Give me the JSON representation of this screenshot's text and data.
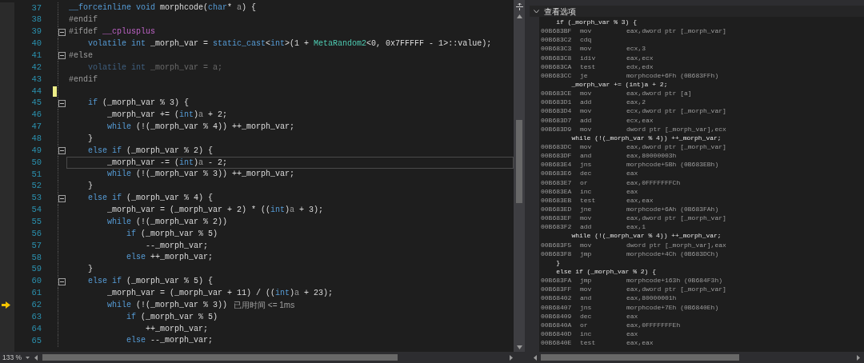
{
  "editor": {
    "lines": [
      {
        "number": "37",
        "fold": false,
        "changed": false,
        "current": false,
        "executing": false,
        "tokens": [
          {
            "kind": "kw",
            "text": "__forceinline void"
          },
          {
            "kind": "plain",
            "text": " morphcode("
          },
          {
            "kind": "kw",
            "text": "char"
          },
          {
            "kind": "plain",
            "text": "* "
          },
          {
            "kind": "param",
            "text": "a"
          },
          {
            "kind": "plain",
            "text": ") {"
          }
        ]
      },
      {
        "number": "38",
        "fold": false,
        "changed": false,
        "current": false,
        "executing": false,
        "tokens": [
          {
            "kind": "pre",
            "text": "#endif"
          }
        ]
      },
      {
        "number": "39",
        "fold": true,
        "changed": false,
        "current": false,
        "executing": false,
        "tokens": [
          {
            "kind": "pre",
            "text": "#ifdef "
          },
          {
            "kind": "macro",
            "text": "__cplusplus"
          }
        ]
      },
      {
        "number": "40",
        "fold": false,
        "changed": false,
        "current": false,
        "executing": false,
        "tokens": [
          {
            "kind": "kw",
            "text": "    volatile int"
          },
          {
            "kind": "plain",
            "text": " _morph_var = "
          },
          {
            "kind": "kw",
            "text": "static_cast"
          },
          {
            "kind": "plain",
            "text": "<"
          },
          {
            "kind": "kw",
            "text": "int"
          },
          {
            "kind": "plain",
            "text": ">(1 + "
          },
          {
            "kind": "type",
            "text": "MetaRandom2"
          },
          {
            "kind": "plain",
            "text": "<0, 0x7FFFFF - 1>::value);"
          }
        ]
      },
      {
        "number": "41",
        "fold": true,
        "changed": false,
        "current": false,
        "executing": false,
        "tokens": [
          {
            "kind": "pre",
            "text": "#else"
          }
        ]
      },
      {
        "number": "42",
        "fold": false,
        "changed": false,
        "current": false,
        "executing": false,
        "tokens": [
          {
            "kind": "dimkw",
            "text": "    volatile int"
          },
          {
            "kind": "dim",
            "text": " _morph_var = a;"
          }
        ]
      },
      {
        "number": "43",
        "fold": false,
        "changed": false,
        "current": false,
        "executing": false,
        "tokens": [
          {
            "kind": "pre",
            "text": "#endif"
          }
        ]
      },
      {
        "number": "44",
        "fold": false,
        "changed": true,
        "current": false,
        "executing": false
      },
      {
        "number": "45",
        "fold": true,
        "changed": false,
        "current": false,
        "executing": false,
        "tokens": [
          {
            "kind": "kw",
            "text": "    if"
          },
          {
            "kind": "plain",
            "text": " (_morph_var % 3) {"
          }
        ]
      },
      {
        "number": "46",
        "fold": false,
        "changed": false,
        "current": false,
        "executing": false,
        "tokens": [
          {
            "kind": "plain",
            "text": "        _morph_var += ("
          },
          {
            "kind": "kw",
            "text": "int"
          },
          {
            "kind": "plain",
            "text": ")"
          },
          {
            "kind": "param",
            "text": "a"
          },
          {
            "kind": "plain",
            "text": " + 2;"
          }
        ]
      },
      {
        "number": "47",
        "fold": false,
        "changed": false,
        "current": false,
        "executing": false,
        "tokens": [
          {
            "kind": "kw",
            "text": "        while"
          },
          {
            "kind": "plain",
            "text": " (!(_morph_var % 4)) ++_morph_var;"
          }
        ]
      },
      {
        "number": "48",
        "fold": false,
        "changed": false,
        "current": false,
        "executing": false,
        "tokens": [
          {
            "kind": "plain",
            "text": "    }"
          }
        ]
      },
      {
        "number": "49",
        "fold": true,
        "changed": false,
        "current": false,
        "executing": false,
        "tokens": [
          {
            "kind": "kw",
            "text": "    else if"
          },
          {
            "kind": "plain",
            "text": " (_morph_var % 2) {"
          }
        ]
      },
      {
        "number": "50",
        "fold": false,
        "changed": false,
        "current": true,
        "executing": false,
        "tokens": [
          {
            "kind": "plain",
            "text": "        _morph_var -= ("
          },
          {
            "kind": "kw",
            "text": "int"
          },
          {
            "kind": "plain",
            "text": ")"
          },
          {
            "kind": "param",
            "text": "a"
          },
          {
            "kind": "plain",
            "text": " - 2;"
          }
        ]
      },
      {
        "number": "51",
        "fold": false,
        "changed": false,
        "current": false,
        "executing": false,
        "tokens": [
          {
            "kind": "kw",
            "text": "        while"
          },
          {
            "kind": "plain",
            "text": " (!(_morph_var % 3)) ++_morph_var;"
          }
        ]
      },
      {
        "number": "52",
        "fold": false,
        "changed": false,
        "current": false,
        "executing": false,
        "tokens": [
          {
            "kind": "plain",
            "text": "    }"
          }
        ]
      },
      {
        "number": "53",
        "fold": true,
        "changed": false,
        "current": false,
        "executing": false,
        "tokens": [
          {
            "kind": "kw",
            "text": "    else if"
          },
          {
            "kind": "plain",
            "text": " (_morph_var % 4) {"
          }
        ]
      },
      {
        "number": "54",
        "fold": false,
        "changed": false,
        "current": false,
        "executing": false,
        "tokens": [
          {
            "kind": "plain",
            "text": "        _morph_var = (_morph_var + 2) * (("
          },
          {
            "kind": "kw",
            "text": "int"
          },
          {
            "kind": "plain",
            "text": ")"
          },
          {
            "kind": "param",
            "text": "a"
          },
          {
            "kind": "plain",
            "text": " + 3);"
          }
        ]
      },
      {
        "number": "55",
        "fold": false,
        "changed": false,
        "current": false,
        "executing": false,
        "tokens": [
          {
            "kind": "kw",
            "text": "        while"
          },
          {
            "kind": "plain",
            "text": " (!(_morph_var % 2))"
          }
        ]
      },
      {
        "number": "56",
        "fold": false,
        "changed": false,
        "current": false,
        "executing": false,
        "tokens": [
          {
            "kind": "kw",
            "text": "            if"
          },
          {
            "kind": "plain",
            "text": " (_morph_var % 5)"
          }
        ]
      },
      {
        "number": "57",
        "fold": false,
        "changed": false,
        "current": false,
        "executing": false,
        "tokens": [
          {
            "kind": "plain",
            "text": "                --_morph_var;"
          }
        ]
      },
      {
        "number": "58",
        "fold": false,
        "changed": false,
        "current": false,
        "executing": false,
        "tokens": [
          {
            "kind": "kw",
            "text": "            else"
          },
          {
            "kind": "plain",
            "text": " ++_morph_var;"
          }
        ]
      },
      {
        "number": "59",
        "fold": false,
        "changed": false,
        "current": false,
        "executing": false,
        "tokens": [
          {
            "kind": "plain",
            "text": "    }"
          }
        ]
      },
      {
        "number": "60",
        "fold": true,
        "changed": false,
        "current": false,
        "executing": false,
        "tokens": [
          {
            "kind": "kw",
            "text": "    else if"
          },
          {
            "kind": "plain",
            "text": " (_morph_var % 5) {"
          }
        ]
      },
      {
        "number": "61",
        "fold": false,
        "changed": false,
        "current": false,
        "executing": false,
        "tokens": [
          {
            "kind": "plain",
            "text": "        _morph_var = (_morph_var + 11) / (("
          },
          {
            "kind": "kw",
            "text": "int"
          },
          {
            "kind": "plain",
            "text": ")"
          },
          {
            "kind": "param",
            "text": "a"
          },
          {
            "kind": "plain",
            "text": " + 23);"
          }
        ]
      },
      {
        "number": "62",
        "fold": false,
        "changed": false,
        "current": false,
        "executing": true,
        "tip": "已用时间 <= 1ms",
        "tokens": [
          {
            "kind": "kw",
            "text": "        while"
          },
          {
            "kind": "plain",
            "text": " (!(_morph_var % 3))"
          }
        ]
      },
      {
        "number": "63",
        "fold": false,
        "changed": false,
        "current": false,
        "executing": false,
        "tokens": [
          {
            "kind": "kw",
            "text": "            if"
          },
          {
            "kind": "plain",
            "text": " (_morph_var % 5)"
          }
        ]
      },
      {
        "number": "64",
        "fold": false,
        "changed": false,
        "current": false,
        "executing": false,
        "tokens": [
          {
            "kind": "plain",
            "text": "                ++_morph_var;"
          }
        ]
      },
      {
        "number": "65",
        "fold": false,
        "changed": false,
        "current": false,
        "executing": false,
        "tokens": [
          {
            "kind": "kw",
            "text": "            else"
          },
          {
            "kind": "plain",
            "text": " --_morph_var;"
          }
        ]
      }
    ]
  },
  "status_bar": {
    "zoom": "133 %"
  },
  "disassembly": {
    "options_label": "查看选项",
    "expanded": true,
    "lines": [
      {
        "kind": "source",
        "text": "    if (_morph_var % 3) {"
      },
      {
        "kind": "instr",
        "addr": "00B683BF",
        "op": "mov",
        "args": "eax,dword ptr [_morph_var]"
      },
      {
        "kind": "instr",
        "addr": "00B683C2",
        "op": "cdq"
      },
      {
        "kind": "instr",
        "addr": "00B683C3",
        "op": "mov",
        "args": "ecx,3"
      },
      {
        "kind": "instr",
        "addr": "00B683C8",
        "op": "idiv",
        "args": "eax,ecx"
      },
      {
        "kind": "instr",
        "addr": "00B683CA",
        "op": "test",
        "args": "edx,edx"
      },
      {
        "kind": "instr",
        "addr": "00B683CC",
        "op": "je",
        "args": "morphcode+6Fh (0B683FFh)"
      },
      {
        "kind": "source",
        "text": "        _morph_var += (int)a + 2;"
      },
      {
        "kind": "instr",
        "addr": "00B683CE",
        "op": "mov",
        "args": "eax,dword ptr [a]"
      },
      {
        "kind": "instr",
        "addr": "00B683D1",
        "op": "add",
        "args": "eax,2"
      },
      {
        "kind": "instr",
        "addr": "00B683D4",
        "op": "mov",
        "args": "ecx,dword ptr [_morph_var]"
      },
      {
        "kind": "instr",
        "addr": "00B683D7",
        "op": "add",
        "args": "ecx,eax"
      },
      {
        "kind": "instr",
        "addr": "00B683D9",
        "op": "mov",
        "args": "dword ptr [_morph_var],ecx"
      },
      {
        "kind": "source",
        "text": "        while (!(_morph_var % 4)) ++_morph_var;"
      },
      {
        "kind": "instr",
        "addr": "00B683DC",
        "op": "mov",
        "args": "eax,dword ptr [_morph_var]"
      },
      {
        "kind": "instr",
        "addr": "00B683DF",
        "op": "and",
        "args": "eax,80000003h"
      },
      {
        "kind": "instr",
        "addr": "00B683E4",
        "op": "jns",
        "args": "morphcode+5Bh (0B683EBh)"
      },
      {
        "kind": "instr",
        "addr": "00B683E6",
        "op": "dec",
        "args": "eax"
      },
      {
        "kind": "instr",
        "addr": "00B683E7",
        "op": "or",
        "args": "eax,0FFFFFFFCh"
      },
      {
        "kind": "instr",
        "addr": "00B683EA",
        "op": "inc",
        "args": "eax"
      },
      {
        "kind": "instr",
        "addr": "00B683EB",
        "op": "test",
        "args": "eax,eax"
      },
      {
        "kind": "instr",
        "addr": "00B683ED",
        "op": "jne",
        "args": "morphcode+6Ah (0B683FAh)"
      },
      {
        "kind": "instr",
        "addr": "00B683EF",
        "op": "mov",
        "args": "eax,dword ptr [_morph_var]"
      },
      {
        "kind": "instr",
        "addr": "00B683F2",
        "op": "add",
        "args": "eax,1"
      },
      {
        "kind": "source",
        "text": "        while (!(_morph_var % 4)) ++_morph_var;"
      },
      {
        "kind": "instr",
        "addr": "00B683F5",
        "op": "mov",
        "args": "dword ptr [_morph_var],eax"
      },
      {
        "kind": "instr",
        "addr": "00B683F8",
        "op": "jmp",
        "args": "morphcode+4Ch (0B683DCh)"
      },
      {
        "kind": "source",
        "text": "    }"
      },
      {
        "kind": "source",
        "text": "    else if (_morph_var % 2) {"
      },
      {
        "kind": "instr",
        "addr": "00B683FA",
        "op": "jmp",
        "args": "morphcode+163h (0B684F3h)"
      },
      {
        "kind": "instr",
        "addr": "00B683FF",
        "op": "mov",
        "args": "eax,dword ptr [_morph_var]"
      },
      {
        "kind": "instr",
        "addr": "00B68402",
        "op": "and",
        "args": "eax,80000001h"
      },
      {
        "kind": "instr",
        "addr": "00B68407",
        "op": "jns",
        "args": "morphcode+7Eh (0B6840Eh)"
      },
      {
        "kind": "instr",
        "addr": "00B68409",
        "op": "dec",
        "args": "eax"
      },
      {
        "kind": "instr",
        "addr": "00B6840A",
        "op": "or",
        "args": "eax,0FFFFFFFEh"
      },
      {
        "kind": "instr",
        "addr": "00B6840D",
        "op": "inc",
        "args": "eax"
      },
      {
        "kind": "instr",
        "addr": "00B6840E",
        "op": "test",
        "args": "eax,eax"
      }
    ]
  }
}
